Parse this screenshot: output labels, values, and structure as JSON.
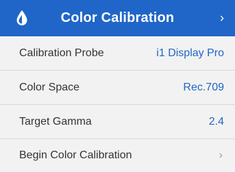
{
  "header": {
    "title": "Color Calibration",
    "icon": "droplet-icon",
    "chevron": "›",
    "color": "#2066c8"
  },
  "rows": [
    {
      "label": "Calibration Probe",
      "value": "i1 Display Pro"
    },
    {
      "label": "Color Space",
      "value": "Rec.709"
    },
    {
      "label": "Target Gamma",
      "value": "2.4"
    },
    {
      "label": "Begin Color Calibration",
      "chevron": "›"
    }
  ],
  "colors": {
    "accent": "#2066c8",
    "background": "#f2f2f2",
    "divider": "#d6d6d6",
    "label": "#333333"
  }
}
